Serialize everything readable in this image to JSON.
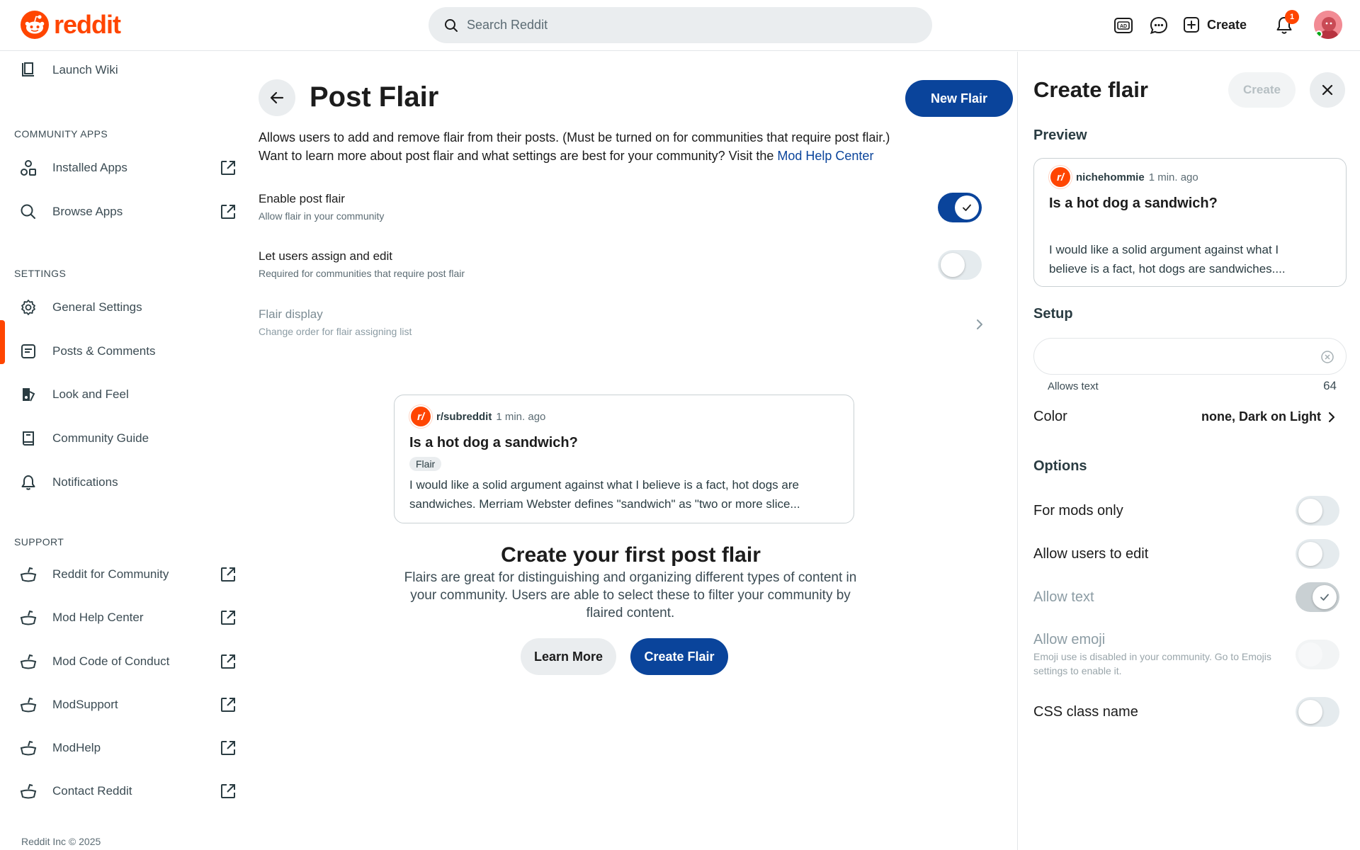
{
  "header": {
    "logo_text": "reddit",
    "search_placeholder": "Search Reddit",
    "create_label": "Create",
    "notification_count": "1",
    "icons": [
      "advertise-icon",
      "chat-icon",
      "plus-square-icon",
      "bell-icon"
    ]
  },
  "sidebar": {
    "launch_wiki": "Launch Wiki",
    "community_apps_heading": "COMMUNITY APPS",
    "installed_apps": "Installed Apps",
    "browse_apps": "Browse Apps",
    "settings_heading": "SETTINGS",
    "general_settings": "General Settings",
    "posts_comments": "Posts & Comments",
    "look_and_feel": "Look and Feel",
    "community_guide": "Community Guide",
    "notifications": "Notifications",
    "support_heading": "SUPPORT",
    "reddit_for_community": "Reddit for Community",
    "mod_help_center": "Mod Help Center",
    "mod_code_of_conduct": "Mod Code of Conduct",
    "modsupport": "ModSupport",
    "modhelp": "ModHelp",
    "contact_reddit": "Contact Reddit",
    "footer": "Reddit Inc © 2025",
    "active_item": "Look and Feel"
  },
  "main": {
    "title": "Post Flair",
    "new_flair": "New Flair",
    "description_line1": "Allows users to add and remove flair from their posts. (Must be turned on for communities that require post flair.)",
    "description_line2": "Want to learn more about post flair and what settings are best for your community? Visit the",
    "description_link": "Mod Help Center",
    "enable_title": "Enable post flair",
    "enable_sub": "Allow flair in your community",
    "enable_on": true,
    "assign_title": "Let users assign and edit",
    "assign_sub": "Required for communities that require post flair",
    "assign_on": false,
    "display_title": "Flair display",
    "display_sub": "Change order for flair assigning list",
    "preview": {
      "subreddit": "r/subreddit",
      "time": "1 min. ago",
      "title": "Is a hot dog a sandwich?",
      "flair": "Flair",
      "body_line1": "I would like a solid argument against what I believe is a fact, hot dogs are",
      "body_line2": "sandwiches. Merriam Webster defines \"sandwich\" as \"two or more slice..."
    },
    "empty_title": "Create your first post flair",
    "empty_desc": "Flairs are great for distinguishing and organizing different types of content in your community. Users are able to select these to filter your community by flaired content.",
    "learn_more": "Learn More",
    "create_flair": "Create Flair"
  },
  "panel": {
    "title": "Create flair",
    "create_label": "Create",
    "preview_heading": "Preview",
    "preview": {
      "user": "nichehommie",
      "time": "1 min. ago",
      "title": "Is a hot dog a sandwich?",
      "body_line1": "I would like a solid argument against what I",
      "body_line2": "believe is a fact, hot dogs are sandwiches...."
    },
    "setup_heading": "Setup",
    "input_value": "",
    "allows_text": "Allows text",
    "char_count": "64",
    "color_label": "Color",
    "color_value": "none, Dark on Light",
    "options_heading": "Options",
    "mods_only": "For mods only",
    "mods_only_on": false,
    "allow_edit": "Allow users to edit",
    "allow_edit_on": false,
    "allow_text": "Allow text",
    "allow_text_on": true,
    "allow_emoji": "Allow emoji",
    "allow_emoji_sub": "Emoji use is disabled in your community. Go to Emojis settings to enable it.",
    "allow_emoji_on": false,
    "css_class": "CSS class name",
    "css_class_on": false
  },
  "colors": {
    "brand": "#ff4500",
    "primary_button": "#0a449b",
    "link": "#0a449b"
  }
}
